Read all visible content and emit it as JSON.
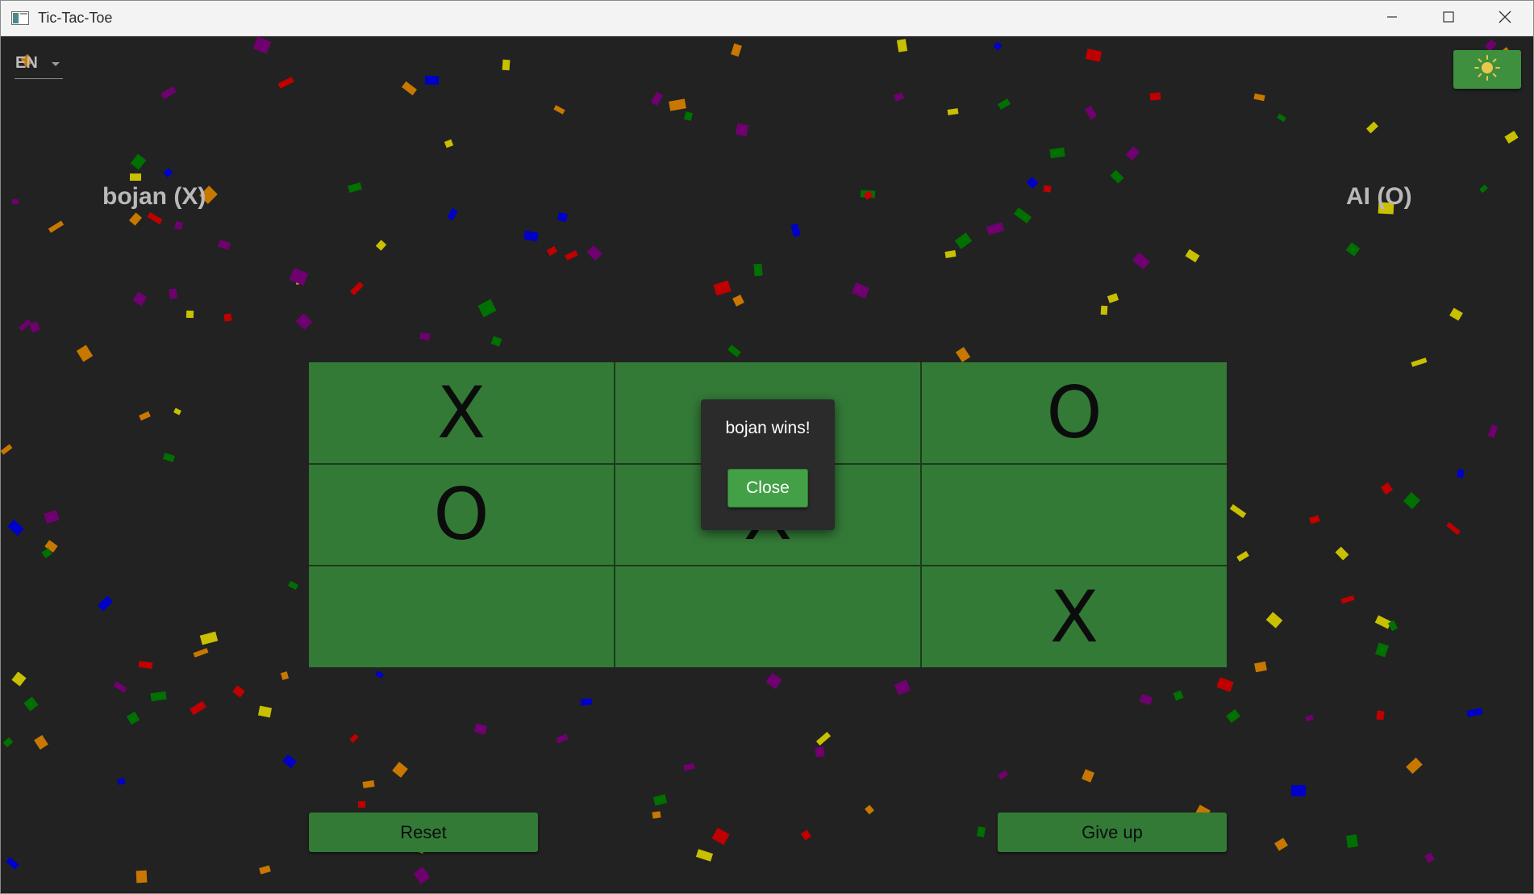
{
  "window": {
    "title": "Tic-Tac-Toe"
  },
  "language": {
    "selected": "EN"
  },
  "players": {
    "left": "bojan (X)",
    "right": "AI (O)"
  },
  "board": {
    "cells": [
      "X",
      "",
      "O",
      "O",
      "X",
      "",
      "",
      "",
      "X"
    ]
  },
  "dialog": {
    "message": "bojan wins!",
    "close_label": "Close"
  },
  "actions": {
    "reset_label": "Reset",
    "give_up_label": "Give up"
  },
  "colors": {
    "background": "#222222",
    "cell": "#337a37",
    "button_accent": "#43a047",
    "confetti": [
      "#c00000",
      "#0000c8",
      "#c8c000",
      "#c87800",
      "#007000",
      "#700070"
    ]
  },
  "icons": {
    "app": "app-icon",
    "minimize": "minimize-icon",
    "maximize": "maximize-icon",
    "close": "close-icon",
    "theme": "sun-icon",
    "dropdown": "chevron-down-icon"
  }
}
